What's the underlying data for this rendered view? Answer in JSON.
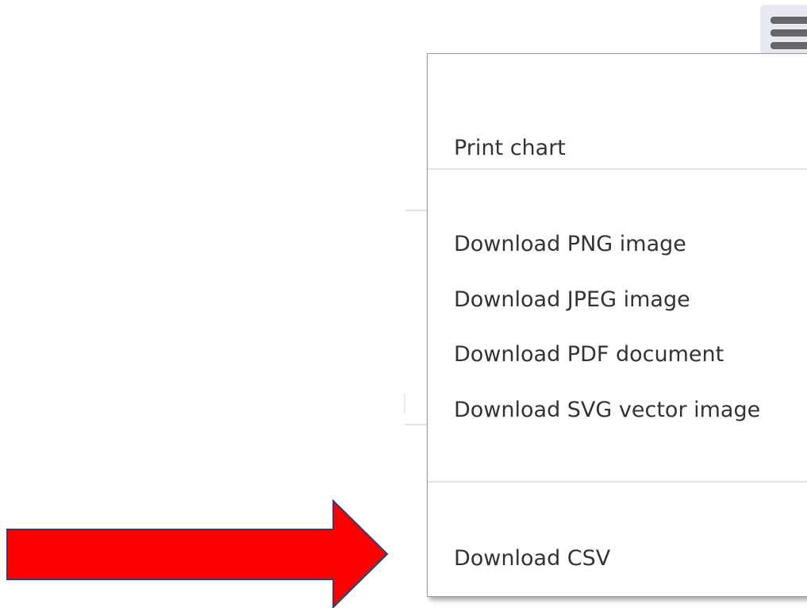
{
  "menu": {
    "items": [
      {
        "label": "Print chart"
      },
      {
        "label": "Download PNG image"
      },
      {
        "label": "Download JPEG image"
      },
      {
        "label": "Download PDF document"
      },
      {
        "label": "Download SVG vector image"
      },
      {
        "label": "Download CSV"
      }
    ]
  },
  "icons": {
    "menu_button": "hamburger-menu-icon",
    "annotation": "red-arrow-right"
  },
  "colors": {
    "arrow_fill": "#ff0000",
    "arrow_stroke": "#2f3f7a",
    "menu_text": "#333333",
    "button_bg": "#e6e9f2"
  }
}
